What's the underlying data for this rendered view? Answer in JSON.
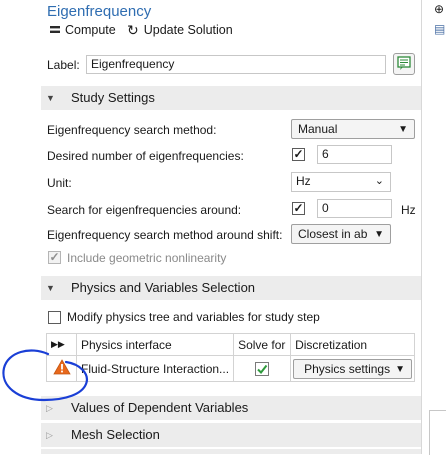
{
  "settings_window": {
    "title": "Eigenfrequency",
    "toolbar": {
      "compute_label": "Compute",
      "update_label": "Update Solution"
    },
    "label_row": {
      "label": "Label:",
      "value": "Eigenfrequency"
    },
    "study_settings": {
      "header": "Study Settings",
      "search_method_label": "Eigenfrequency search method:",
      "search_method_value": "Manual",
      "desired_number_label": "Desired number of eigenfrequencies:",
      "desired_number_checked": true,
      "desired_number_value": "6",
      "unit_label": "Unit:",
      "unit_value": "Hz",
      "search_around_label": "Search for eigenfrequencies around:",
      "search_around_checked": true,
      "search_around_value": "0",
      "search_around_unit": "Hz",
      "shift_label": "Eigenfrequency search method around shift:",
      "shift_value": "Closest in ab",
      "geom_nonlinearity_label": "Include geometric nonlinearity",
      "geom_nonlinearity_checked": true
    },
    "physics_section": {
      "header": "Physics and Variables Selection",
      "modify_label": "Modify physics tree and variables for study step",
      "modify_checked": false,
      "table": {
        "columns": [
          "Physics interface",
          "Solve for",
          "Discretization"
        ],
        "rows": [
          {
            "status": "warning",
            "physics_interface": "Fluid-Structure Interaction...",
            "solve_for": true,
            "discretization": "Physics settings"
          }
        ]
      }
    },
    "collapsed_sections": [
      "Values of Dependent Variables",
      "Mesh Selection"
    ]
  },
  "colors": {
    "title_blue": "#2f6db1",
    "section_bg": "#ececec",
    "warning_orange": "#e8681c",
    "check_green": "#2e9a3c",
    "annotation_blue": "#1a3fd6"
  }
}
